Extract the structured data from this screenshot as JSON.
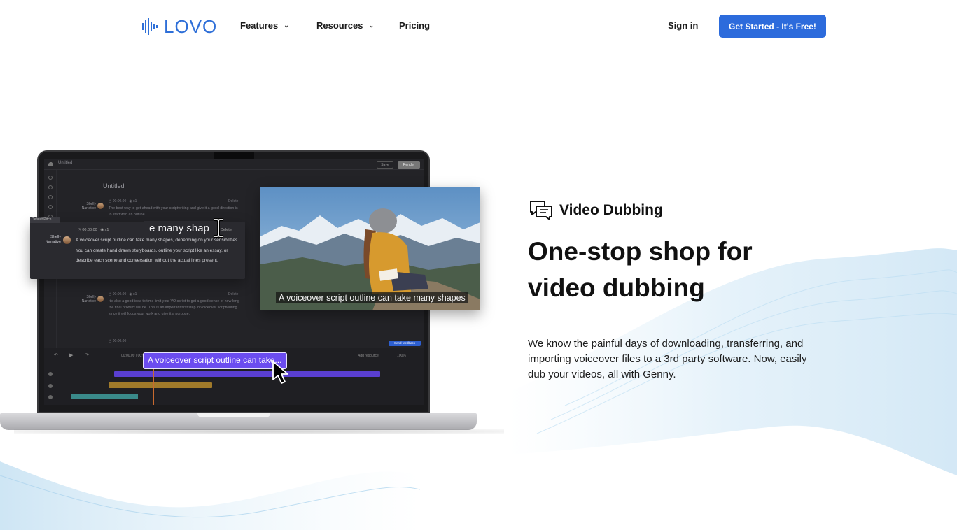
{
  "nav": {
    "logo_text": "LOVO",
    "features_label": "Features",
    "resources_label": "Resources",
    "pricing_label": "Pricing",
    "sign_in_label": "Sign in",
    "cta_label": "Get Started - It's Free!"
  },
  "mockup": {
    "file_name": "Untitled",
    "save_label": "Save",
    "render_label": "Render",
    "project_title": "Untitled",
    "blocks": [
      {
        "speaker": "Shelly",
        "role": "Narrative",
        "time": "00:00.00",
        "speed": "x1",
        "delete": "Delete",
        "text": "The best way to get ahead with your scriptwriting and give it a good direction is to start with an outline."
      },
      {
        "speaker": "Shelly",
        "role": "Narrative",
        "time": "00:00.00",
        "speed": "x1",
        "delete": "Delete",
        "text": "It's also a good idea to time limit your VO script to get a good sense of how long the final product will be. This is an important first step in voiceover scriptwriting since it will focus your work and give it a purpose."
      }
    ],
    "bottom_meta": "00:00.00",
    "popup": {
      "tag": "Default Pitch",
      "speaker": "Shelly",
      "role": "Narrative",
      "time": "00:00.00",
      "speed": "x1",
      "delete": "Delete",
      "float_text": "e many shap",
      "text": "A voiceover script outline can take many shapes, depending on your sensibilities. You can create hand drawn storyboards, outline your script like an essay, or describe each scene and conversation without the actual lines present."
    },
    "photo_caption": "A voiceover script outline can take many shapes",
    "subtitle_text": "A voiceover script outline can take...",
    "timeline": {
      "timecode": "00:00.09 / 00:00.00",
      "add_resource": "Add resource",
      "zoom": "100%",
      "feedback": "Send feedback"
    }
  },
  "feature": {
    "icon": "chat-bubbles-icon",
    "label": "Video Dubbing",
    "headline_line1": "One-stop shop for",
    "headline_line2": "video dubbing",
    "description": "We know the painful days of downloading, transferring, and importing voiceover files to a 3rd party software. Now, easily dub your videos, all with Genny."
  },
  "colors": {
    "brand": "#2e6fd8",
    "cta": "#2c6bdc",
    "subtitle": "#6b4cf0",
    "wave": "#8ec3e6"
  }
}
